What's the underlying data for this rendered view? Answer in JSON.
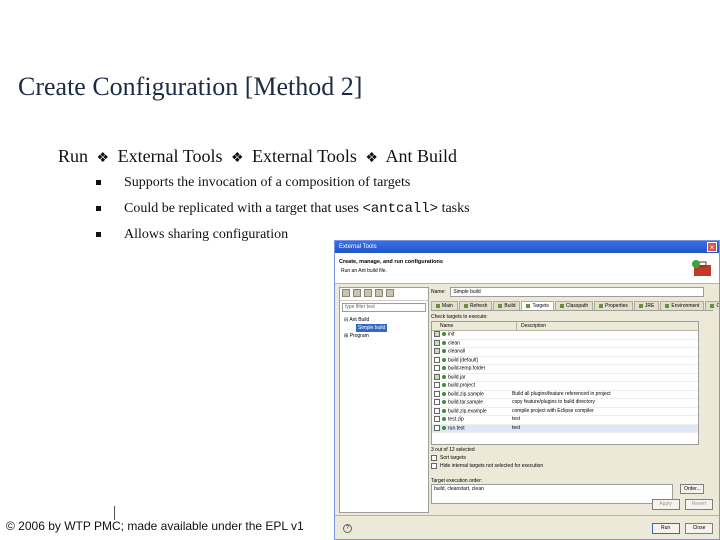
{
  "slide": {
    "title": "Create Configuration [Method 2]",
    "breadcrumb": [
      "Run",
      "External Tools",
      "External Tools",
      "Ant Build"
    ],
    "bullets": [
      {
        "text": "Supports the invocation of a composition of targets"
      },
      {
        "prefix": "Could be replicated with a target that uses ",
        "code": "<antcall>",
        "suffix": " tasks"
      },
      {
        "text": "Allows sharing configuration"
      }
    ],
    "footer": "© 2006 by WTP PMC; made available under the EPL v1"
  },
  "dialog": {
    "title": "External Tools",
    "header_title": "Create, manage, and run configurations",
    "header_sub": "Run an Ant build file.",
    "filter_placeholder": "type filter text",
    "tree": {
      "group": "Ant Build",
      "selected": "Simple build",
      "other": "Program"
    },
    "name_label": "Name:",
    "name_value": "Simple build",
    "tabs": [
      "Main",
      "Refresh",
      "Build",
      "Targets",
      "Classpath",
      "Properties",
      "JRE",
      "Environment",
      "Common"
    ],
    "active_tab": "Targets",
    "check_label": "Check targets to execute:",
    "columns": [
      "Name",
      "Description"
    ],
    "targets": [
      {
        "name": "init",
        "desc": "",
        "checked": true
      },
      {
        "name": "clean",
        "desc": "",
        "checked": true
      },
      {
        "name": "cleanall",
        "desc": "",
        "checked": true
      },
      {
        "name": "build [default]",
        "desc": "",
        "checked": false
      },
      {
        "name": "build-temp.folder",
        "desc": "",
        "checked": false
      },
      {
        "name": "build.jar",
        "desc": "",
        "checked": true
      },
      {
        "name": "build.project",
        "desc": "",
        "checked": false
      },
      {
        "name": "build.zip.sample",
        "desc": "Build all plugins/feature referenced in project",
        "checked": false
      },
      {
        "name": "build.tar.sample",
        "desc": "copy feature/plugins to build directory",
        "checked": false
      },
      {
        "name": "build.zip.example",
        "desc": "compile project with Eclipse compiler",
        "checked": false
      },
      {
        "name": "test.zip",
        "desc": "test",
        "checked": false
      },
      {
        "name": "run.test",
        "desc": "test",
        "checked": false
      }
    ],
    "status": "3 out of 12 selected",
    "opt_sort": "Sort targets",
    "opt_hide": "Hide internal targets not selected for execution",
    "order_label": "Target execution order:",
    "order_value": "build, cleanstart, clean",
    "order_button": "Order...",
    "apply": "Apply",
    "revert": "Revert",
    "run": "Run",
    "close": "Close",
    "help": "?"
  }
}
